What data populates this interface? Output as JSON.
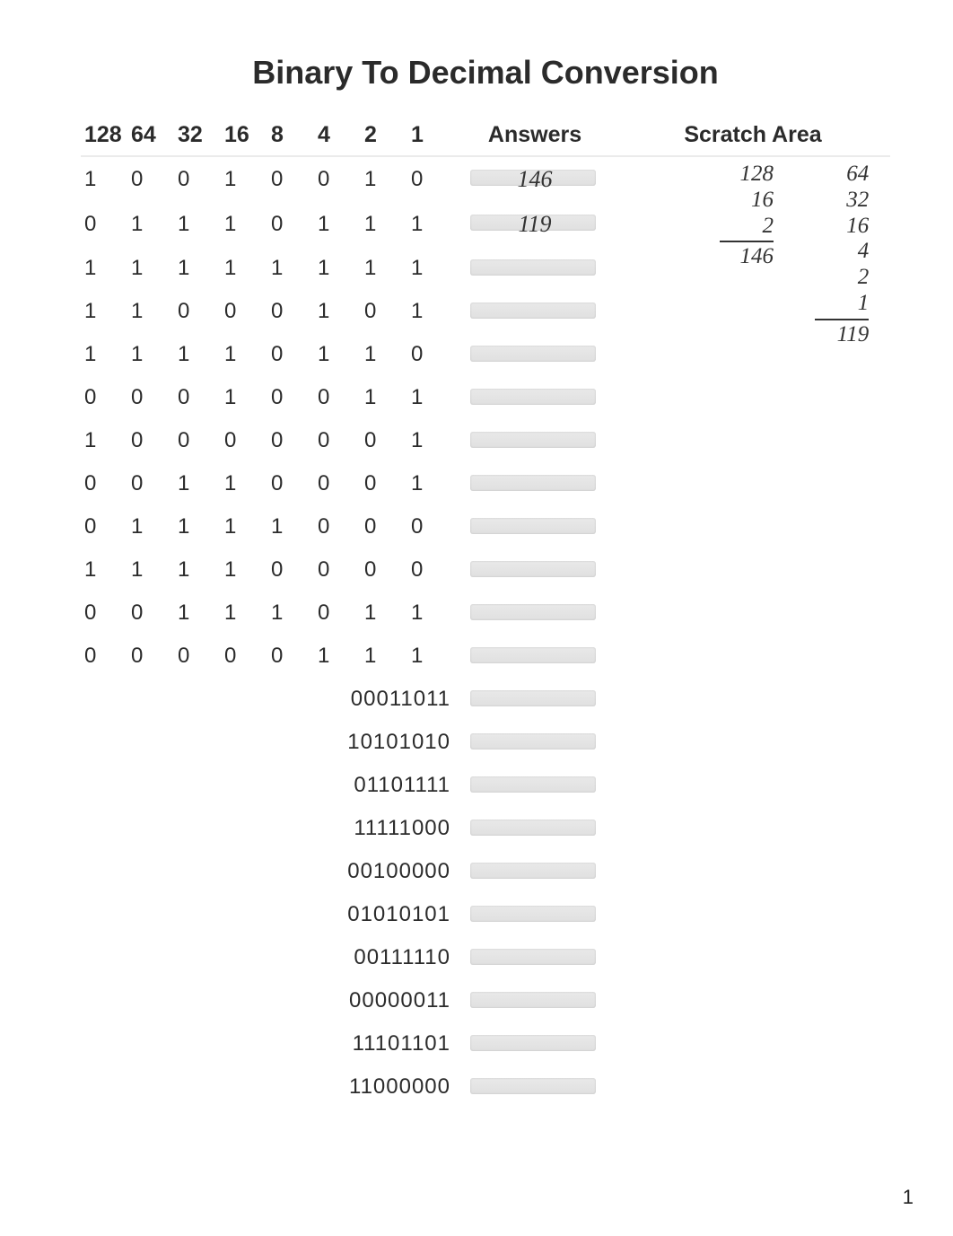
{
  "title": "Binary To Decimal Conversion",
  "headers": {
    "b128": "128",
    "b64": "64",
    "b32": "32",
    "b16": "16",
    "b8": "8",
    "b4": "4",
    "b2": "2",
    "b1": "1",
    "answers": "Answers",
    "scratch": "Scratch Area"
  },
  "rows": [
    {
      "bits": [
        "1",
        "0",
        "0",
        "1",
        "0",
        "0",
        "1",
        "0"
      ],
      "answer": "146"
    },
    {
      "bits": [
        "0",
        "1",
        "1",
        "1",
        "0",
        "1",
        "1",
        "1"
      ],
      "answer": "119"
    },
    {
      "bits": [
        "1",
        "1",
        "1",
        "1",
        "1",
        "1",
        "1",
        "1"
      ],
      "answer": ""
    },
    {
      "bits": [
        "1",
        "1",
        "0",
        "0",
        "0",
        "1",
        "0",
        "1"
      ],
      "answer": ""
    },
    {
      "bits": [
        "1",
        "1",
        "1",
        "1",
        "0",
        "1",
        "1",
        "0"
      ],
      "answer": ""
    },
    {
      "bits": [
        "0",
        "0",
        "0",
        "1",
        "0",
        "0",
        "1",
        "1"
      ],
      "answer": ""
    },
    {
      "bits": [
        "1",
        "0",
        "0",
        "0",
        "0",
        "0",
        "0",
        "1"
      ],
      "answer": ""
    },
    {
      "bits": [
        "0",
        "0",
        "1",
        "1",
        "0",
        "0",
        "0",
        "1"
      ],
      "answer": ""
    },
    {
      "bits": [
        "0",
        "1",
        "1",
        "1",
        "1",
        "0",
        "0",
        "0"
      ],
      "answer": ""
    },
    {
      "bits": [
        "1",
        "1",
        "1",
        "1",
        "0",
        "0",
        "0",
        "0"
      ],
      "answer": ""
    },
    {
      "bits": [
        "0",
        "0",
        "1",
        "1",
        "1",
        "0",
        "1",
        "1"
      ],
      "answer": ""
    },
    {
      "bits": [
        "0",
        "0",
        "0",
        "0",
        "0",
        "1",
        "1",
        "1"
      ],
      "answer": ""
    }
  ],
  "strings": [
    "00011011",
    "10101010",
    "01101111",
    "11111000",
    "00100000",
    "01010101",
    "00111110",
    "00000011",
    "11101101",
    "11000000"
  ],
  "scratch": {
    "c1": [
      "128",
      "16",
      "2",
      "146"
    ],
    "c2": [
      "64",
      "32",
      "16",
      "4",
      "2",
      "1",
      "119"
    ]
  },
  "page_number": "1"
}
